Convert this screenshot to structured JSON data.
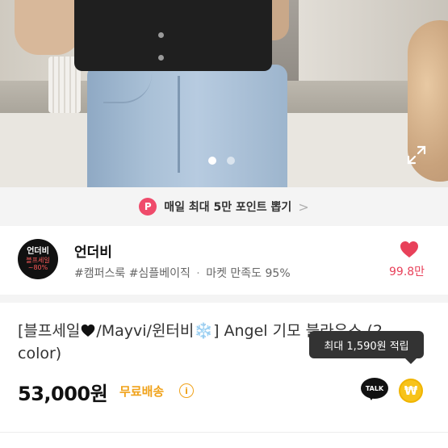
{
  "photo": {
    "slide_count": 2,
    "active_slide": 1,
    "expand_icon": "expand-icon"
  },
  "banner": {
    "badge": "P",
    "text": "매일 최대 5만 포인트 뽑기",
    "chevron": ">",
    "badge_color": "#ef4b6b"
  },
  "shop": {
    "logo_line1": "언더비",
    "logo_line2": "블프세일",
    "logo_line3": "~80%",
    "name": "언더비",
    "tags": "#캠퍼스룩 #심플베이직",
    "satisfaction_sep": "·",
    "satisfaction": "마켓 만족도 95%",
    "like_rate": "99.8만",
    "heart_color": "#e8415a"
  },
  "product": {
    "title_part1": "[블프세일",
    "title_part2": "/Mayvi/윈터비",
    "title_snow": "❄️",
    "title_part3": "] Angel 기모 블라우스 (2 color)",
    "price": "53,000원",
    "shipping": "무료배송",
    "info_symbol": "i",
    "points_tooltip": "최대 1,590원 적립",
    "talk_label": "TALK",
    "won_symbol": "₩",
    "shipping_color": "#f0a21a",
    "points_color": "#f7c31a"
  }
}
